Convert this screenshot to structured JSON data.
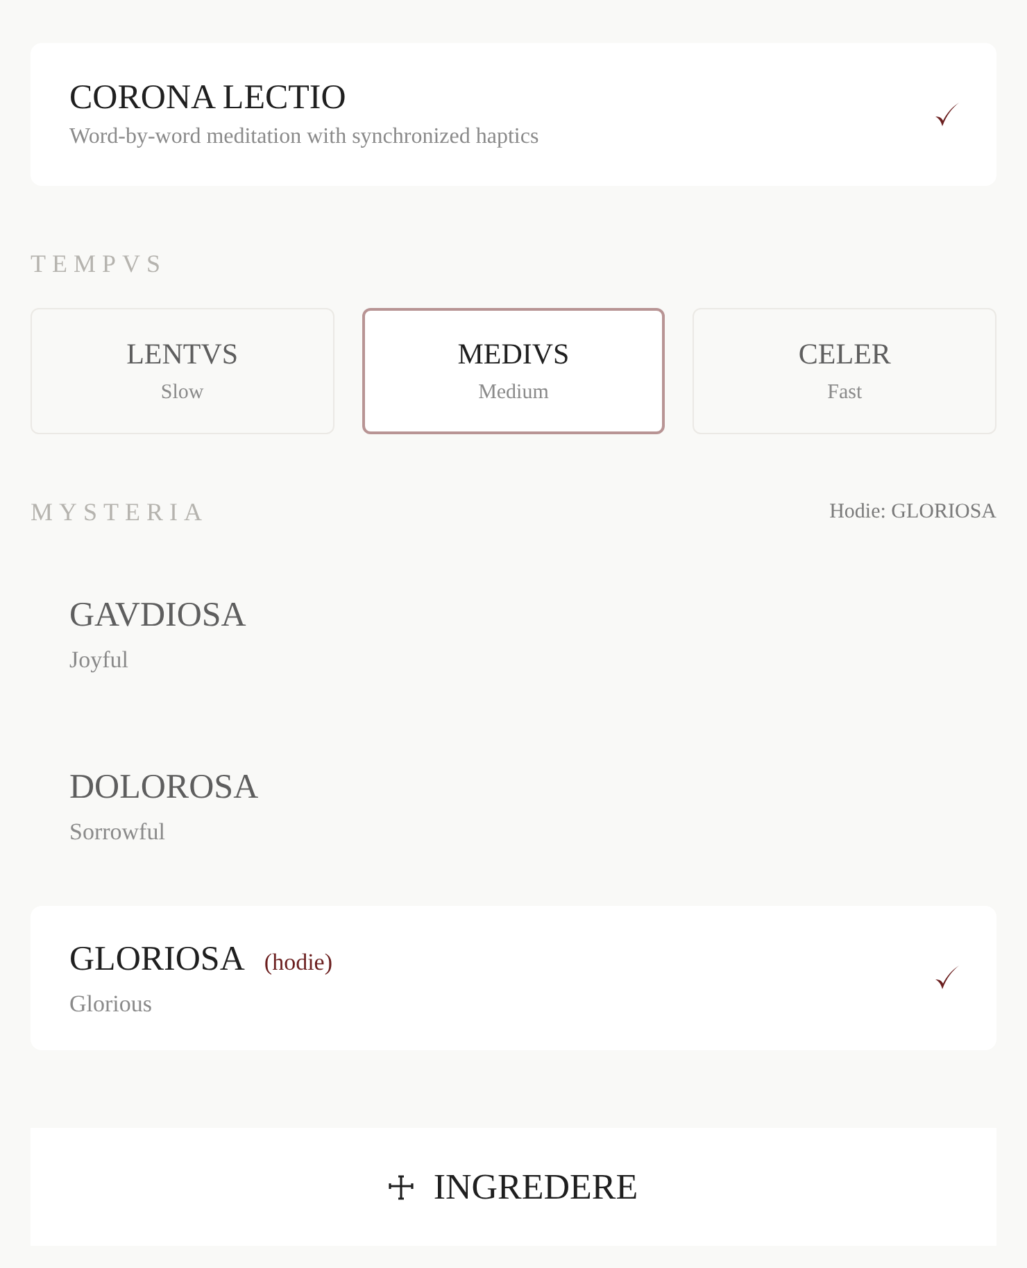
{
  "mode": {
    "title": "CORONA LECTIO",
    "subtitle": "Word-by-word meditation with synchronized haptics",
    "checked": true
  },
  "tempo": {
    "heading": "TEMPVS",
    "options": [
      {
        "label": "LENTVS",
        "sublabel": "Slow",
        "selected": false
      },
      {
        "label": "MEDIVS",
        "sublabel": "Medium",
        "selected": true
      },
      {
        "label": "CELER",
        "sublabel": "Fast",
        "selected": false
      }
    ]
  },
  "mysteries": {
    "heading": "MYSTERIA",
    "today_note": "Hodie: GLORIOSA",
    "items": [
      {
        "title": "GAVDIOSA",
        "subtitle": "Joyful",
        "selected": false
      },
      {
        "title": "DOLOROSA",
        "subtitle": "Sorrowful",
        "selected": false
      },
      {
        "title": "GLORIOSA",
        "subtitle": "Glorious",
        "tag": "(hodie)",
        "selected": true
      }
    ]
  },
  "enter_button": {
    "label": "INGREDERE"
  }
}
